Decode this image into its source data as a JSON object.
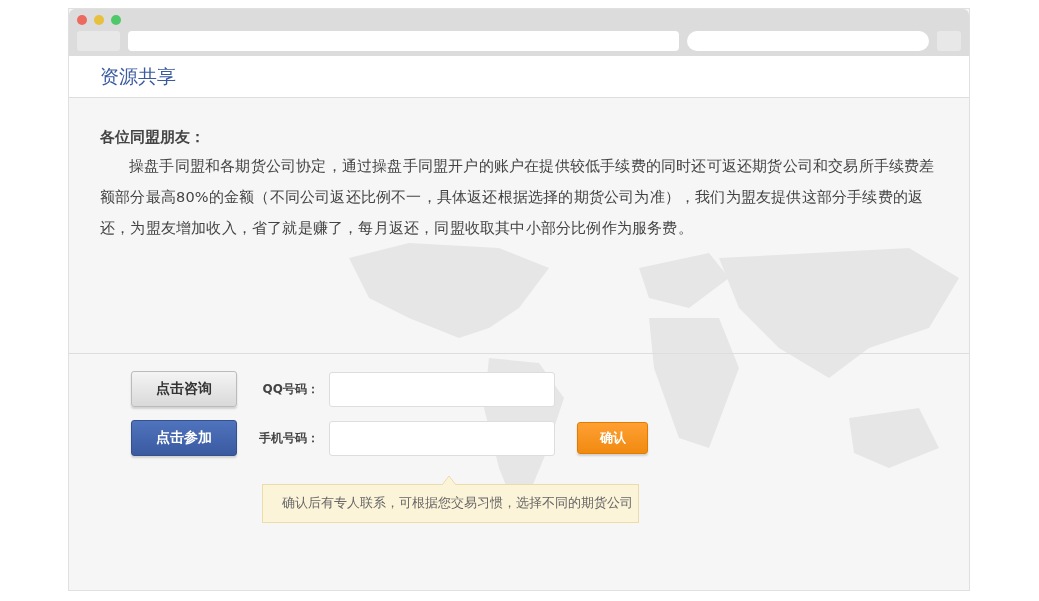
{
  "header": {
    "title": "资源共享"
  },
  "intro": {
    "greeting": "各位同盟朋友：",
    "body": "操盘手同盟和各期货公司协定，通过操盘手同盟开户的账户在提供较低手续费的同时还可返还期货公司和交易所手续费差额部分最高80%的金额（不同公司返还比例不一，具体返还根据选择的期货公司为准），我们为盟友提供这部分手续费的返还，为盟友增加收入，省了就是赚了，每月返还，同盟收取其中小部分比例作为服务费。"
  },
  "buttons": [
    {
      "label": "点击咨询",
      "kind": "gray"
    },
    {
      "label": "点击参加",
      "kind": "blue"
    }
  ],
  "fields": [
    {
      "label": "QQ号码："
    },
    {
      "label": "手机号码："
    }
  ],
  "confirm": {
    "label": "确认"
  },
  "tip": "确认后有专人联系，可根据您交易习惯，选择不同的期货公司"
}
